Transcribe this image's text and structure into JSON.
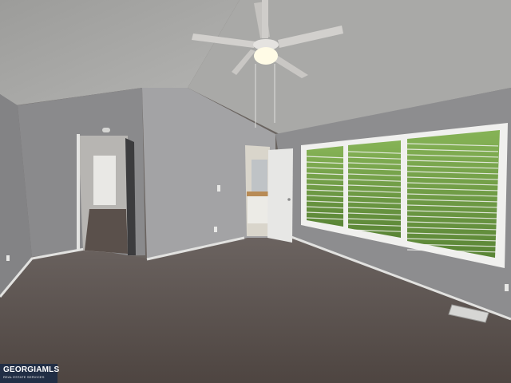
{
  "photo": {
    "subject": "Empty bedroom with vaulted textured ceiling, ceiling fan, carpet and large window"
  },
  "watermark": {
    "brand": "GEORGIAMLS",
    "tagline": "REAL ESTATE SERVICES"
  },
  "colors": {
    "wall": "#88888a",
    "wall_light": "#a7a7a9",
    "ceiling": "#9a9a98",
    "carpet": "#5e534d",
    "trim": "#e6e6e4",
    "foliage": "#6f9b45"
  }
}
